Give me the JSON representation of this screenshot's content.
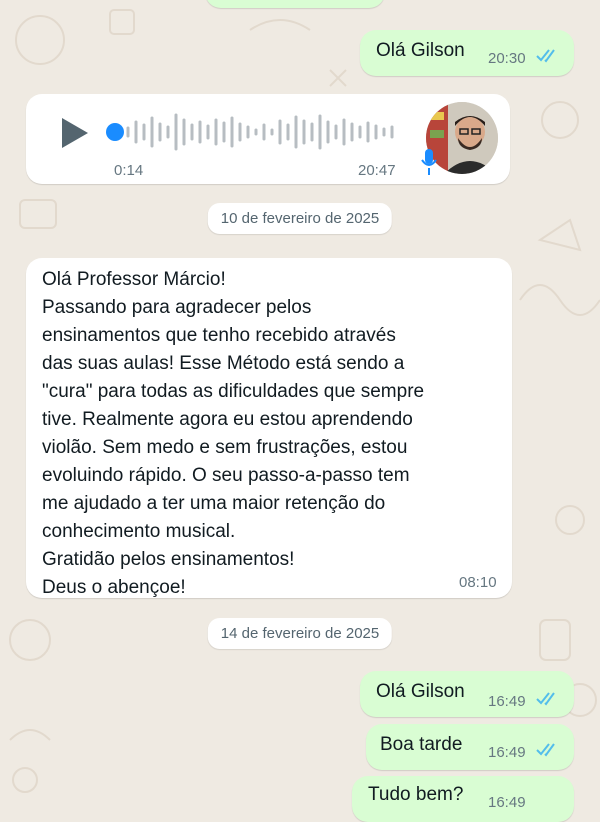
{
  "messages": {
    "first_out": {
      "text": "Olá Gilson",
      "time": "20:30"
    },
    "voice_note": {
      "duration": "0:14",
      "time": "20:47",
      "progress": 0.0
    },
    "date_1": "10 de fevereiro de 2025",
    "long_in": {
      "text": "Olá Professor Márcio!\nPassando para agradecer pelos\nensinamentos que tenho recebido através\ndas suas aulas! Esse Método está sendo a\n\"cura\" para todas as dificuldades que sempre\ntive. Realmente agora eu estou aprendendo\nviolão. Sem medo e sem frustrações,  estou\nevoluindo rápido. O seu passo-a-passo tem\nme ajudado a ter uma maior retenção do\nconhecimento musical.\nGratidão pelos ensinamentos!\nDeus o abençoe!",
      "time": "08:10"
    },
    "date_2": "14 de fevereiro de 2025",
    "out_1": {
      "text": "Olá Gilson",
      "time": "16:49"
    },
    "out_2": {
      "text": "Boa tarde",
      "time": "16:49"
    },
    "out_3": {
      "text": "Tudo bem?",
      "time": "16:49"
    }
  },
  "colors": {
    "chat_bg": "#efeae2",
    "outgoing_bubble": "#d9fdd3",
    "incoming_bubble": "#ffffff",
    "read_ticks": "#53bdeb",
    "timestamp": "#667781"
  },
  "icons": [
    "play-icon",
    "double-check-icon",
    "microphone-icon",
    "avatar"
  ]
}
